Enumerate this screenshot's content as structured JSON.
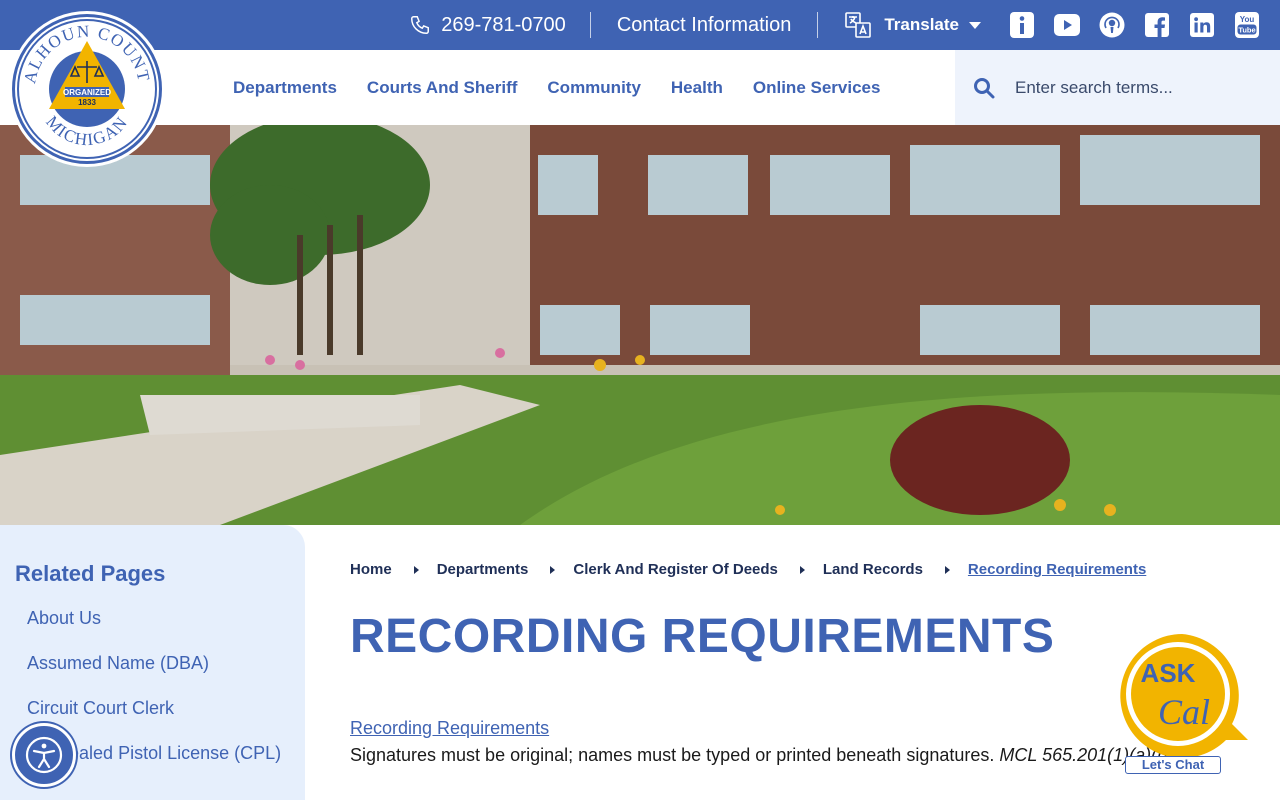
{
  "topbar": {
    "phone": "269-781-0700",
    "contact_label": "Contact Information",
    "translate_label": "Translate",
    "social": [
      {
        "icon": "info-icon"
      },
      {
        "icon": "youtube-play-icon"
      },
      {
        "icon": "podcast-icon"
      },
      {
        "icon": "facebook-icon"
      },
      {
        "icon": "linkedin-icon"
      },
      {
        "icon": "youtube-logo-icon"
      }
    ]
  },
  "logo": {
    "top_text": "CALHOUN COUNTY",
    "bottom_text": "MICHIGAN",
    "center_line1": "ORGANIZED",
    "center_line2": "1833"
  },
  "nav": {
    "items": [
      "Departments",
      "Courts And Sheriff",
      "Community",
      "Health",
      "Online Services"
    ]
  },
  "search": {
    "placeholder": "Enter search terms..."
  },
  "sidebar": {
    "title": "Related Pages",
    "items": [
      "About Us",
      "Assumed Name (DBA)",
      "Circuit Court Clerk",
      "Concealed Pistol License (CPL)"
    ]
  },
  "breadcrumb": {
    "items": [
      "Home",
      "Departments",
      "Clerk And Register Of Deeds",
      "Land Records"
    ],
    "current": "Recording Requirements"
  },
  "content": {
    "title": "RECORDING REQUIREMENTS",
    "section_link": "Recording Requirements",
    "body_text": "Signatures must be original; names must be typed or printed beneath signatures.",
    "body_citation": "MCL 565.201(1)(a)(b)(c)"
  },
  "askcal": {
    "line1": "ASK",
    "line2": "Cal",
    "chat_label": "Let's Chat"
  },
  "colors": {
    "brand_blue": "#3f63b3",
    "gold": "#f2b400",
    "sidebar_bg": "#e6effc",
    "search_bg": "#eef3fc"
  }
}
